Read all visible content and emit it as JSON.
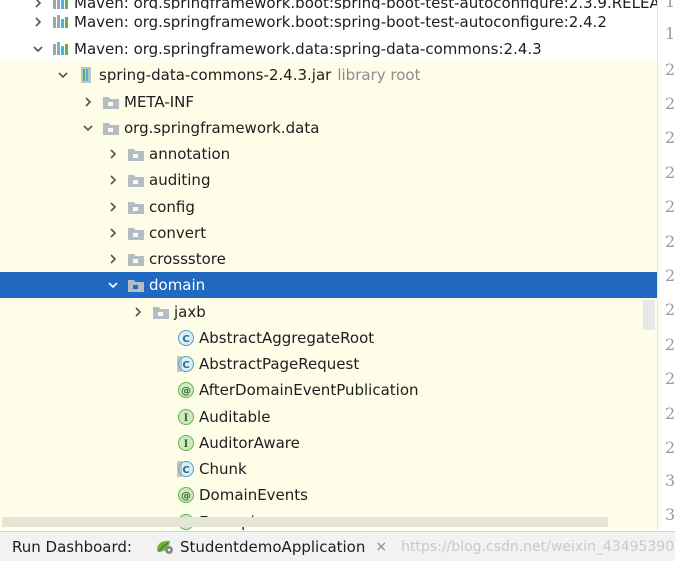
{
  "tree": {
    "rows": [
      {
        "label": "Maven: org.springframework.boot:spring-boot-test-autoconfigure:2.3.9.RELEA",
        "hint": "",
        "icon": "library-icon",
        "expanded": false
      },
      {
        "label": "Maven: org.springframework.boot:spring-boot-test-autoconfigure:2.4.2",
        "hint": "",
        "icon": "library-icon",
        "expanded": false
      },
      {
        "label": "Maven: org.springframework.data:spring-data-commons:2.4.3",
        "hint": "",
        "icon": "library-icon",
        "expanded": true
      },
      {
        "label": "spring-data-commons-2.4.3.jar",
        "hint": "library root",
        "icon": "jar-icon",
        "expanded": true
      },
      {
        "label": "META-INF",
        "hint": "",
        "icon": "folder-icon",
        "expanded": false
      },
      {
        "label": "org.springframework.data",
        "hint": "",
        "icon": "package-icon",
        "expanded": true
      },
      {
        "label": "annotation",
        "hint": "",
        "icon": "package-icon",
        "expanded": false
      },
      {
        "label": "auditing",
        "hint": "",
        "icon": "package-icon",
        "expanded": false
      },
      {
        "label": "config",
        "hint": "",
        "icon": "package-icon",
        "expanded": false
      },
      {
        "label": "convert",
        "hint": "",
        "icon": "package-icon",
        "expanded": false
      },
      {
        "label": "crossstore",
        "hint": "",
        "icon": "package-icon",
        "expanded": false
      },
      {
        "label": "domain",
        "hint": "",
        "icon": "package-icon",
        "expanded": true
      },
      {
        "label": "jaxb",
        "hint": "",
        "icon": "package-icon",
        "expanded": false
      },
      {
        "label": "AbstractAggregateRoot",
        "hint": "",
        "icon": "class-icon",
        "badge": "C"
      },
      {
        "label": "AbstractPageRequest",
        "hint": "",
        "icon": "abstract-class-icon",
        "badge": "C"
      },
      {
        "label": "AfterDomainEventPublication",
        "hint": "",
        "icon": "annotation-icon",
        "badge": "@"
      },
      {
        "label": "Auditable",
        "hint": "",
        "icon": "interface-icon",
        "badge": "I"
      },
      {
        "label": "AuditorAware",
        "hint": "",
        "icon": "interface-icon",
        "badge": "I"
      },
      {
        "label": "Chunk",
        "hint": "",
        "icon": "abstract-class-icon",
        "badge": "C"
      },
      {
        "label": "DomainEvents",
        "hint": "",
        "icon": "annotation-icon",
        "badge": "@"
      },
      {
        "label": "Example",
        "hint": "",
        "icon": "interface-icon",
        "badge": "I"
      }
    ]
  },
  "gutter": {
    "numbers": [
      "1",
      "1",
      "2",
      "2",
      "2",
      "2",
      "2",
      "2",
      "2",
      "2",
      "2",
      "2",
      "2",
      "2",
      "3",
      "3",
      "3",
      "3",
      "3"
    ]
  },
  "bottom": {
    "title": "Run Dashboard:",
    "tab_label": "StudentdemoApplication",
    "close_glyph": "×",
    "watermark": "https://blog.csdn.net/weixin_43495390"
  },
  "colors": {
    "selection": "#2168c0",
    "tree_background": "#fdfde8",
    "class_icon": "#4aa0c8",
    "interface_icon": "#62b543",
    "annotation_icon": "#62b543"
  }
}
